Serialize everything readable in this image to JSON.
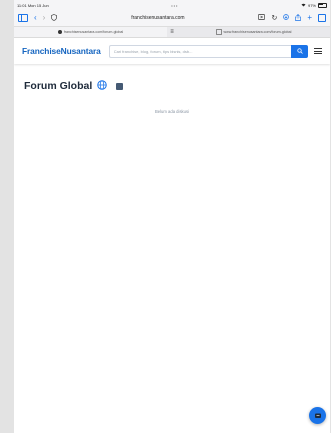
{
  "status_bar": {
    "time": "11:01 Mon 15 Jun",
    "center_dots": "•••",
    "battery": "97%"
  },
  "browser": {
    "address": "franchisenusantara.com",
    "tabs": [
      {
        "label": "franchisenusantara.com/forum-global"
      },
      {
        "label": "www.franchisenusantara.com/forum-global"
      }
    ],
    "tab_separator": "≡"
  },
  "site": {
    "logo": "FranchiseNusantara",
    "search_placeholder": "Cari franchise, blog, forum, tips bisnis, dsb..."
  },
  "forum": {
    "title": "Forum Global",
    "empty_message": "Belum ada diskusi"
  },
  "colors": {
    "brand": "#1565c0",
    "accent": "#1a73e8"
  }
}
